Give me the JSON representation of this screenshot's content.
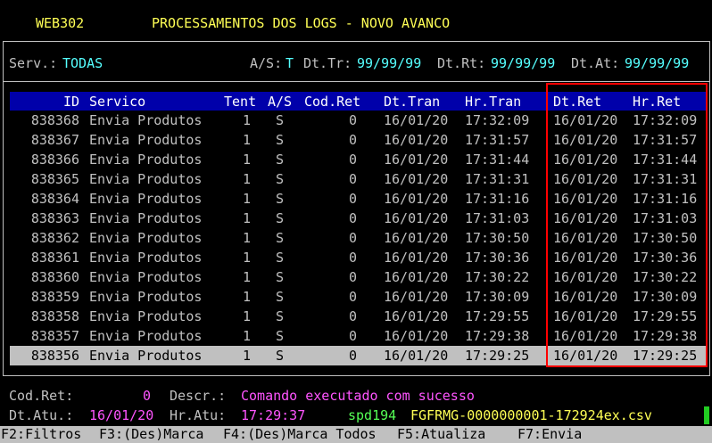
{
  "header": {
    "code": "WEB302",
    "title": "PROCESSAMENTOS DOS LOGS - NOVO AVANCO"
  },
  "filters": {
    "serv_label": "Serv.:",
    "serv_value": "TODAS",
    "as_label": "A/S:",
    "as_value": "T",
    "dttr_label": "Dt.Tr:",
    "dttr_value": "99/99/99",
    "dtrt_label": "Dt.Rt:",
    "dtrt_value": "99/99/99",
    "dtat_label": "Dt.At:",
    "dtat_value": "99/99/99"
  },
  "grid": {
    "columns": {
      "id": "ID",
      "servico": "Servico",
      "tent": "Tent",
      "as": "A/S",
      "codret": "Cod.Ret",
      "dttran": "Dt.Tran",
      "hrtran": "Hr.Tran",
      "dtret": "Dt.Ret",
      "hrret": "Hr.Ret"
    },
    "rows": [
      {
        "id": "838368",
        "servico": "Envia Produtos",
        "tent": "1",
        "as": "S",
        "codret": "0",
        "dttran": "16/01/20",
        "hrtran": "17:32:09",
        "dtret": "16/01/20",
        "hrret": "17:32:09"
      },
      {
        "id": "838367",
        "servico": "Envia Produtos",
        "tent": "1",
        "as": "S",
        "codret": "0",
        "dttran": "16/01/20",
        "hrtran": "17:31:57",
        "dtret": "16/01/20",
        "hrret": "17:31:57"
      },
      {
        "id": "838366",
        "servico": "Envia Produtos",
        "tent": "1",
        "as": "S",
        "codret": "0",
        "dttran": "16/01/20",
        "hrtran": "17:31:44",
        "dtret": "16/01/20",
        "hrret": "17:31:44"
      },
      {
        "id": "838365",
        "servico": "Envia Produtos",
        "tent": "1",
        "as": "S",
        "codret": "0",
        "dttran": "16/01/20",
        "hrtran": "17:31:31",
        "dtret": "16/01/20",
        "hrret": "17:31:31"
      },
      {
        "id": "838364",
        "servico": "Envia Produtos",
        "tent": "1",
        "as": "S",
        "codret": "0",
        "dttran": "16/01/20",
        "hrtran": "17:31:16",
        "dtret": "16/01/20",
        "hrret": "17:31:16"
      },
      {
        "id": "838363",
        "servico": "Envia Produtos",
        "tent": "1",
        "as": "S",
        "codret": "0",
        "dttran": "16/01/20",
        "hrtran": "17:31:03",
        "dtret": "16/01/20",
        "hrret": "17:31:03"
      },
      {
        "id": "838362",
        "servico": "Envia Produtos",
        "tent": "1",
        "as": "S",
        "codret": "0",
        "dttran": "16/01/20",
        "hrtran": "17:30:50",
        "dtret": "16/01/20",
        "hrret": "17:30:50"
      },
      {
        "id": "838361",
        "servico": "Envia Produtos",
        "tent": "1",
        "as": "S",
        "codret": "0",
        "dttran": "16/01/20",
        "hrtran": "17:30:36",
        "dtret": "16/01/20",
        "hrret": "17:30:36"
      },
      {
        "id": "838360",
        "servico": "Envia Produtos",
        "tent": "1",
        "as": "S",
        "codret": "0",
        "dttran": "16/01/20",
        "hrtran": "17:30:22",
        "dtret": "16/01/20",
        "hrret": "17:30:22"
      },
      {
        "id": "838359",
        "servico": "Envia Produtos",
        "tent": "1",
        "as": "S",
        "codret": "0",
        "dttran": "16/01/20",
        "hrtran": "17:30:09",
        "dtret": "16/01/20",
        "hrret": "17:30:09"
      },
      {
        "id": "838358",
        "servico": "Envia Produtos",
        "tent": "1",
        "as": "S",
        "codret": "0",
        "dttran": "16/01/20",
        "hrtran": "17:29:55",
        "dtret": "16/01/20",
        "hrret": "17:29:55"
      },
      {
        "id": "838357",
        "servico": "Envia Produtos",
        "tent": "1",
        "as": "S",
        "codret": "0",
        "dttran": "16/01/20",
        "hrtran": "17:29:38",
        "dtret": "16/01/20",
        "hrret": "17:29:38"
      },
      {
        "id": "838356",
        "servico": "Envia Produtos",
        "tent": "1",
        "as": "S",
        "codret": "0",
        "dttran": "16/01/20",
        "hrtran": "17:29:25",
        "dtret": "16/01/20",
        "hrret": "17:29:25"
      }
    ],
    "selected_index": 12
  },
  "details": {
    "codret_label": "Cod.Ret:",
    "codret_value": "0",
    "descr_label": "Descr.:",
    "descr_value": "Comando executado com sucesso",
    "dtatu_label": "Dt.Atu.:",
    "dtatu_value": "16/01/20",
    "hratu_label": "Hr.Atu:",
    "hratu_value": "17:29:37",
    "user": "spd194",
    "file": "FGFRMG-0000000001-172924ex.csv"
  },
  "function_keys": {
    "f2": "F2:Filtros",
    "f3": "F3:(Des)Marca",
    "f4": "F4:(Des)Marca Todos",
    "f5": "F5:Atualiza",
    "f7": "F7:Envia"
  }
}
